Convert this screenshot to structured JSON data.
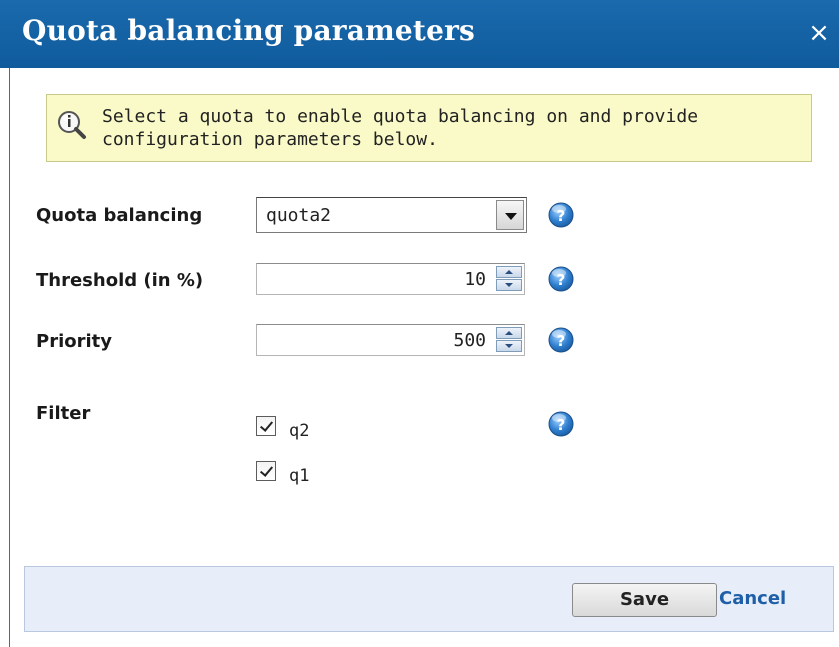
{
  "dialog": {
    "title": "Quota balancing parameters",
    "close_glyph": "×"
  },
  "info": {
    "icon": "info-magnifier-icon",
    "text": "Select a quota to enable quota balancing on and provide configuration parameters below."
  },
  "form": {
    "quota_balancing": {
      "label": "Quota balancing",
      "value": "quota2"
    },
    "threshold": {
      "label": "Threshold (in %)",
      "value": "10"
    },
    "priority": {
      "label": "Priority",
      "value": "500"
    },
    "filter": {
      "label": "Filter",
      "options": [
        {
          "label": "q2",
          "checked": true
        },
        {
          "label": "q1",
          "checked": true
        }
      ]
    }
  },
  "footer": {
    "save_label": "Save",
    "cancel_label": "Cancel"
  },
  "colors": {
    "title_bar": "#1565a7",
    "info_background": "#fafac8",
    "footer_background": "#e8eef9",
    "link": "#1f5fa8",
    "help_icon": "#2f7fd0"
  },
  "icons": {
    "help": "help-question-icon",
    "close": "close-icon"
  }
}
